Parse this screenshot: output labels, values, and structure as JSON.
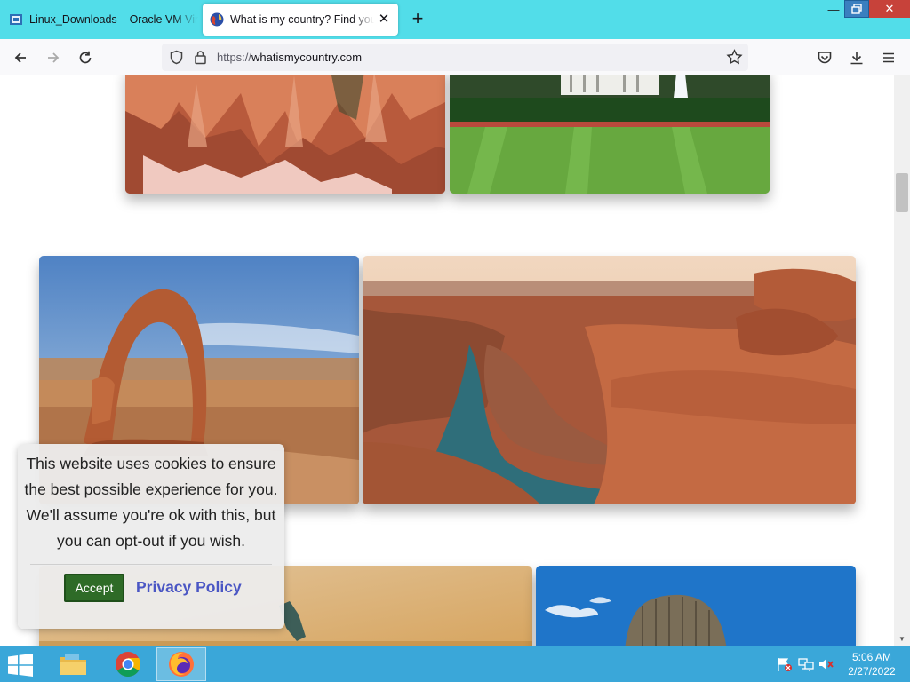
{
  "browser": {
    "tabs": [
      {
        "title": "Linux_Downloads – Oracle VM VirtualBox",
        "active": false,
        "icon": "virtualbox-icon"
      },
      {
        "title": "What is my country? Find your country",
        "active": true,
        "icon": "globe-icon"
      }
    ],
    "url_scheme": "https://",
    "url_host": "whatismycountry.com"
  },
  "cookie_banner": {
    "message": "This website uses cookies to ensure the best possible experience for you. We'll assume you're ok with this, but you can opt-out if you wish.",
    "accept_label": "Accept",
    "privacy_label": "Privacy Policy"
  },
  "taskbar": {
    "apps": [
      "file-explorer-icon",
      "chrome-icon",
      "firefox-icon"
    ],
    "active_app": "firefox-icon",
    "time": "5:06 AM",
    "date": "2/27/2022"
  },
  "colors": {
    "tabstrip": "#52dde9",
    "accept": "#2e6b27",
    "privacy_link": "#4a56c4",
    "taskbar": "#3aa7d9"
  }
}
